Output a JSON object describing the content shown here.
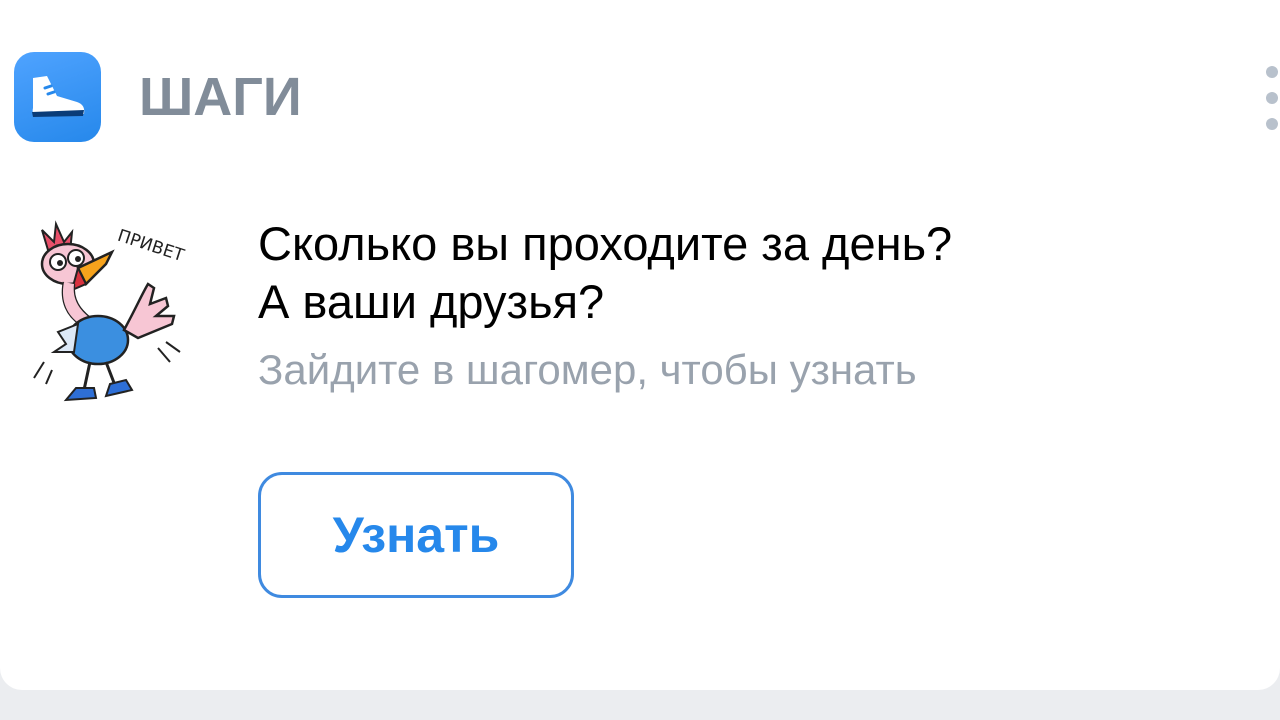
{
  "app": {
    "title": "ШАГИ",
    "icon": "sneaker-icon",
    "accent_color": "#2688eb"
  },
  "widget": {
    "headline_line1": "Сколько вы проходите за день?",
    "headline_line2": "А ваши друзья?",
    "subtitle": "Зайдите в шагомер, чтобы узнать",
    "button_label": "Узнать",
    "sticker_text": "ПРИВЕТ",
    "menu_icon": "more-vertical-icon"
  }
}
